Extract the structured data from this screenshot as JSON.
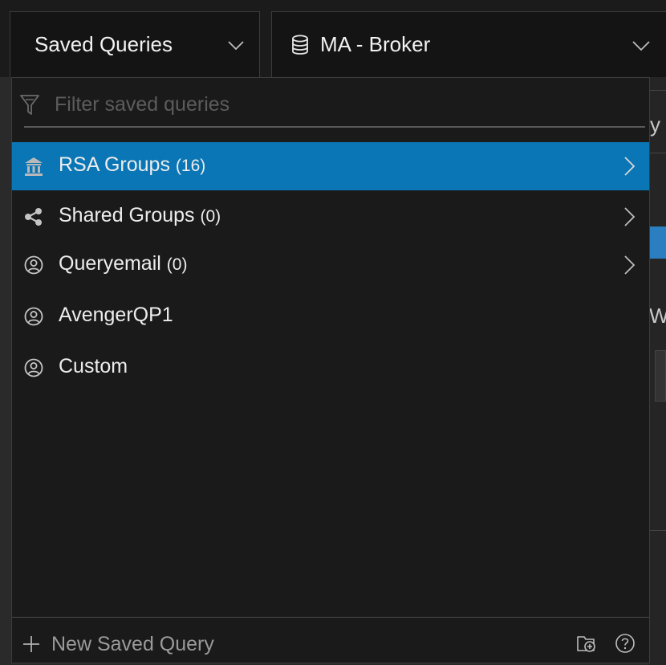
{
  "header": {
    "saved_queries_label": "Saved Queries",
    "service_label": "MA - Broker"
  },
  "filter": {
    "placeholder": "Filter saved queries"
  },
  "groups": [
    {
      "icon": "rsa-building-icon",
      "name": "RSA Groups",
      "count": "(16)",
      "expandable": true,
      "selected": true
    },
    {
      "icon": "share-icon",
      "name": "Shared Groups",
      "count": "(0)",
      "expandable": true,
      "selected": false
    },
    {
      "icon": "user-circle-icon",
      "name": "Queryemail",
      "count": "(0)",
      "expandable": true,
      "selected": false
    },
    {
      "icon": "user-circle-icon",
      "name": "AvengerQP1",
      "count": "",
      "expandable": false,
      "selected": false
    },
    {
      "icon": "user-circle-icon",
      "name": "Custom",
      "count": "",
      "expandable": false,
      "selected": false
    }
  ],
  "footer": {
    "new_label": "New Saved Query",
    "icons": [
      "add-folder-icon",
      "help-icon"
    ]
  },
  "background_fragments": [
    "y",
    "W"
  ],
  "colors": {
    "selected_bg": "#0a76b5",
    "panel_bg": "#1a1a1a",
    "text": "#ededed",
    "muted": "#9a9a9a"
  }
}
